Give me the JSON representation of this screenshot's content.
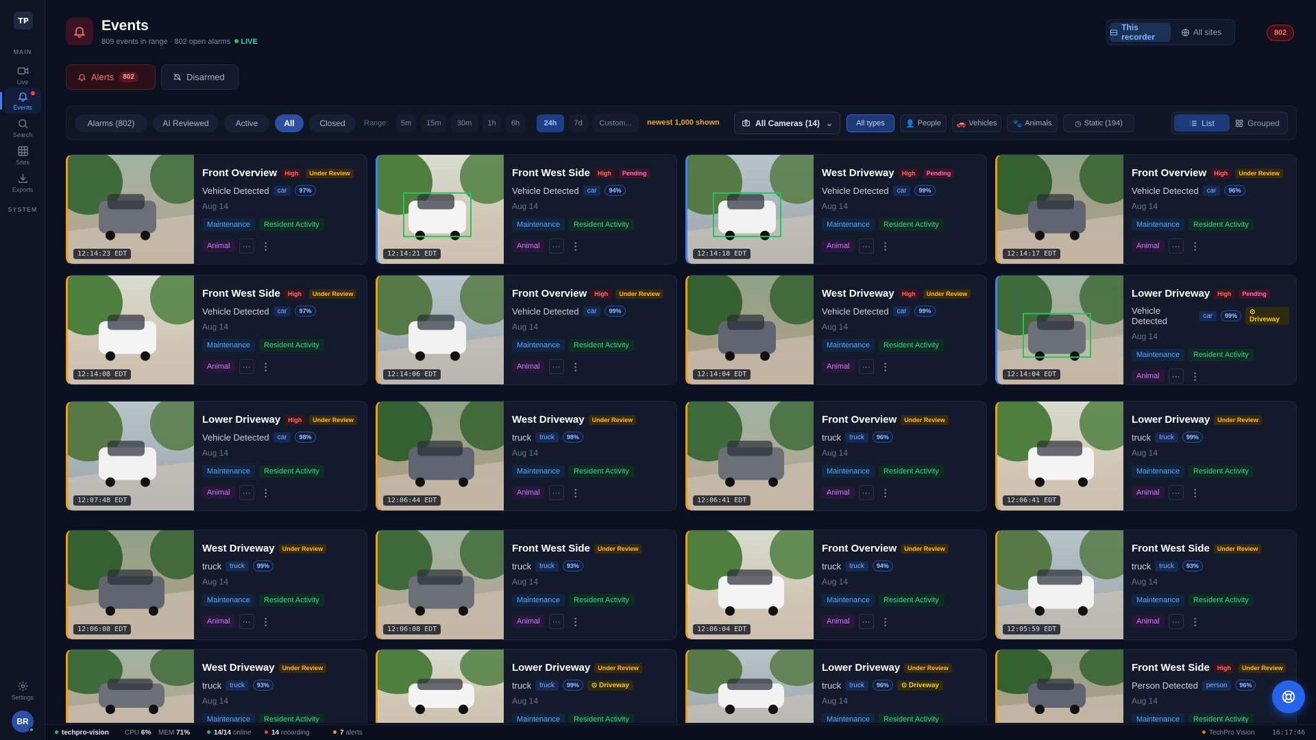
{
  "sidebar": {
    "logo": "TP",
    "section_main": "MAIN",
    "section_system": "SYSTEM",
    "items": [
      {
        "label": "Live",
        "icon": "video-icon"
      },
      {
        "label": "Events",
        "icon": "bell-icon"
      },
      {
        "label": "Search",
        "icon": "search-icon"
      },
      {
        "label": "Sites",
        "icon": "grid-icon"
      },
      {
        "label": "Exports",
        "icon": "download-icon"
      }
    ],
    "settings_label": "Settings",
    "user_initials": "BR"
  },
  "header": {
    "title": "Events",
    "subtitle": "809 events in range · 802 open alarms",
    "live": "LIVE",
    "scope_this": "This recorder",
    "scope_all": "All sites",
    "alarm_count": "802"
  },
  "modes": {
    "alerts_label": "Alerts",
    "alerts_count": "802",
    "disarmed_label": "Disarmed"
  },
  "filters": {
    "status": [
      "Alarms (802)",
      "AI Reviewed",
      "Active",
      "All",
      "Closed"
    ],
    "active_status": "All",
    "range_label": "Range:",
    "ranges": [
      "5m",
      "15m",
      "30m",
      "1h",
      "6h",
      "24h",
      "7d",
      "Custom..."
    ],
    "active_range": "24h",
    "shown_note": "newest 1,000 shown",
    "camera_select": "All Cameras (14)",
    "types": [
      "All types",
      "People",
      "Vehicles",
      "Animals",
      "Static (194)"
    ],
    "view_list": "List",
    "view_grouped": "Grouped"
  },
  "tags": {
    "maintenance": "Maintenance",
    "resident": "Resident Activity",
    "animal": "Animal",
    "more": "···",
    "kebab": "⋮"
  },
  "events": [
    {
      "camera": "Front Overview",
      "severity": "High",
      "status": "Under Review",
      "detection": "Vehicle Detected",
      "class": "car",
      "confidence": "97%",
      "date": "Aug 14",
      "time": "12:14:23 EDT"
    },
    {
      "camera": "Front West Side",
      "severity": "High",
      "status": "Pending",
      "detection": "Vehicle Detected",
      "class": "car",
      "confidence": "94%",
      "date": "Aug 14",
      "time": "12:14:21 EDT"
    },
    {
      "camera": "West Driveway",
      "severity": "High",
      "status": "Pending",
      "detection": "Vehicle Detected",
      "class": "car",
      "confidence": "99%",
      "date": "Aug 14",
      "time": "12:14:18 EDT"
    },
    {
      "camera": "Front Overview",
      "severity": "High",
      "status": "Under Review",
      "detection": "Vehicle Detected",
      "class": "car",
      "confidence": "96%",
      "date": "Aug 14",
      "time": "12:14:17 EDT"
    },
    {
      "camera": "Front West Side",
      "severity": "High",
      "status": "Under Review",
      "detection": "Vehicle Detected",
      "class": "car",
      "confidence": "97%",
      "date": "Aug 14",
      "time": "12:14:08 EDT"
    },
    {
      "camera": "Front Overview",
      "severity": "High",
      "status": "Under Review",
      "detection": "Vehicle Detected",
      "class": "car",
      "confidence": "99%",
      "date": "Aug 14",
      "time": "12:14:06 EDT"
    },
    {
      "camera": "West Driveway",
      "severity": "High",
      "status": "Under Review",
      "detection": "Vehicle Detected",
      "class": "car",
      "confidence": "99%",
      "date": "Aug 14",
      "time": "12:14:04 EDT"
    },
    {
      "camera": "Lower Driveway",
      "severity": "High",
      "status": "Pending",
      "detection": "Vehicle Detected",
      "class": "car",
      "confidence": "99%",
      "zone": "Driveway",
      "date": "Aug 14",
      "time": "12:14:04 EDT"
    },
    {
      "camera": "Lower Driveway",
      "severity": "High",
      "status": "Under Review",
      "detection": "Vehicle Detected",
      "class": "car",
      "confidence": "98%",
      "date": "Aug 14",
      "time": "12:07:48 EDT"
    },
    {
      "camera": "West Driveway",
      "status": "Under Review",
      "detection": "truck",
      "class": "truck",
      "confidence": "98%",
      "date": "Aug 14",
      "time": "12:06:44 EDT"
    },
    {
      "camera": "Front Overview",
      "status": "Under Review",
      "detection": "truck",
      "class": "truck",
      "confidence": "96%",
      "date": "Aug 14",
      "time": "12:06:41 EDT"
    },
    {
      "camera": "Lower Driveway",
      "status": "Under Review",
      "detection": "truck",
      "class": "truck",
      "confidence": "99%",
      "date": "Aug 14",
      "time": "12:06:41 EDT"
    },
    {
      "camera": "West Driveway",
      "status": "Under Review",
      "detection": "truck",
      "class": "truck",
      "confidence": "99%",
      "date": "Aug 14",
      "time": "12:06:08 EDT"
    },
    {
      "camera": "Front West Side",
      "status": "Under Review",
      "detection": "truck",
      "class": "truck",
      "confidence": "93%",
      "date": "Aug 14",
      "time": "12:06:08 EDT"
    },
    {
      "camera": "Front Overview",
      "status": "Under Review",
      "detection": "truck",
      "class": "truck",
      "confidence": "94%",
      "date": "Aug 14",
      "time": "12:06:04 EDT"
    },
    {
      "camera": "Front West Side",
      "status": "Under Review",
      "detection": "truck",
      "class": "truck",
      "confidence": "93%",
      "date": "Aug 14",
      "time": "12:05:59 EDT"
    },
    {
      "camera": "West Driveway",
      "status": "Under Review",
      "detection": "truck",
      "class": "truck",
      "confidence": "93%",
      "date": "Aug 14",
      "time": ""
    },
    {
      "camera": "Lower Driveway",
      "status": "Under Review",
      "detection": "truck",
      "class": "truck",
      "confidence": "99%",
      "zone": "Driveway",
      "date": "Aug 14",
      "time": ""
    },
    {
      "camera": "Lower Driveway",
      "status": "Under Review",
      "detection": "truck",
      "class": "truck",
      "confidence": "96%",
      "zone": "Driveway",
      "date": "Aug 14",
      "time": ""
    },
    {
      "camera": "Front West Side",
      "severity": "High",
      "status": "Under Review",
      "detection": "Person Detected",
      "class": "person",
      "confidence": "96%",
      "date": "Aug 14",
      "time": ""
    }
  ],
  "statusbar": {
    "host": "techpro-vision",
    "cpu_label": "CPU",
    "cpu": "6%",
    "mem_label": "MEM",
    "mem": "71%",
    "online": "14/14",
    "online_label": "online",
    "recording": "14",
    "recording_label": "recording",
    "alerts": "7",
    "alerts_label": "alerts",
    "brand": "TechPro Vision",
    "clock": "16:17:46"
  },
  "colors": {
    "accent": "#3b82f6",
    "alert": "#ef4444",
    "review": "#f59e0b",
    "live": "#22c55e"
  }
}
